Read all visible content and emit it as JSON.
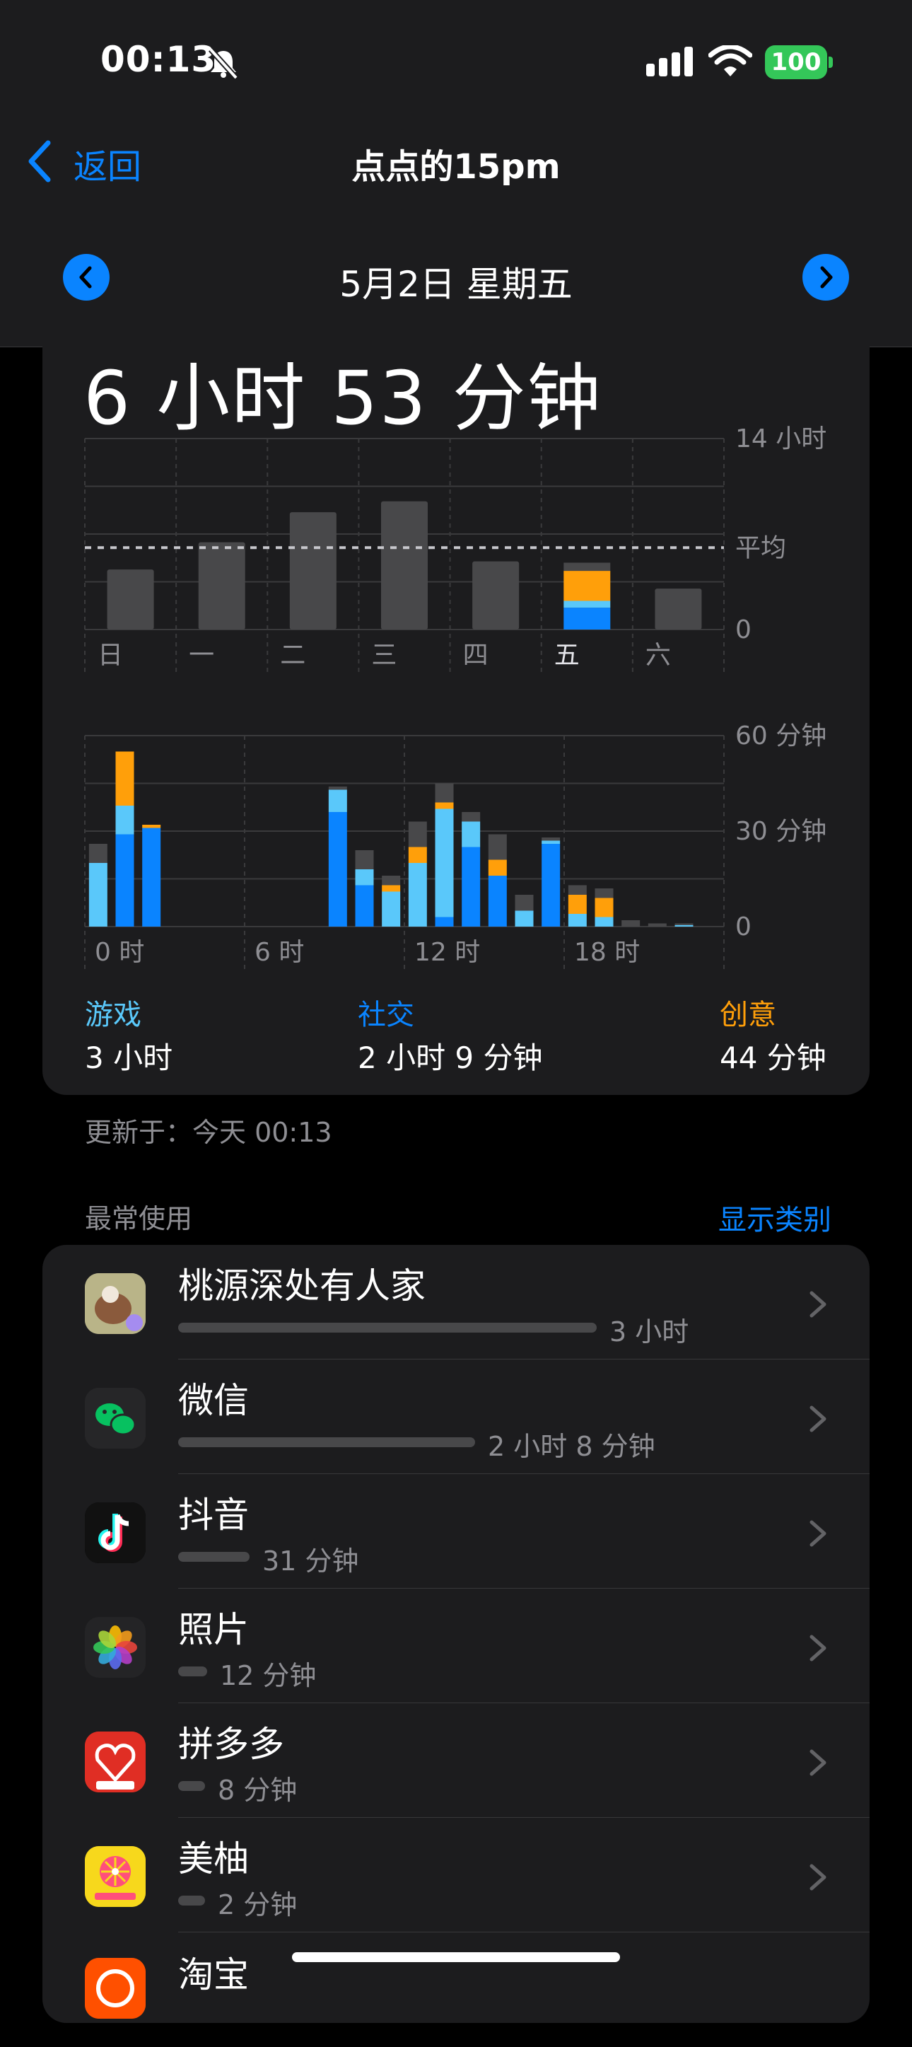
{
  "status": {
    "time": "00:13",
    "battery": "100"
  },
  "nav": {
    "back": "返回",
    "title": "点点的15pm"
  },
  "date": {
    "title": "5月2日 星期五"
  },
  "summary": {
    "total": "6 小时 53 分钟"
  },
  "colors": {
    "game": "#5ac8fa",
    "social": "#0a84ff",
    "creative": "#ff9f0a",
    "other": "#48484a",
    "accent": "#0a84ff"
  },
  "weekly": {
    "top_label": "14 小时",
    "avg_label": "平均",
    "zero_label": "0",
    "days": [
      "日",
      "一",
      "二",
      "三",
      "四",
      "五",
      "六"
    ],
    "totals_hours": [
      4.4,
      6.4,
      8.6,
      9.4,
      5.0,
      4.8,
      3.0
    ],
    "today": {
      "social": 1.6,
      "game": 0.5,
      "creative": 2.2,
      "other": 0.6
    },
    "average_hours": 6.0
  },
  "hourly": {
    "top_label": "60 分钟",
    "mid_label": "30 分钟",
    "zero_label": "0",
    "x_labels": [
      "0 时",
      "6 时",
      "12 时",
      "18 时"
    ],
    "bars": [
      {
        "h": 0,
        "social": 0,
        "game": 20,
        "creative": 0,
        "other": 6
      },
      {
        "h": 1,
        "social": 29,
        "game": 9,
        "creative": 17,
        "other": 0
      },
      {
        "h": 2,
        "social": 31,
        "game": 0,
        "creative": 1,
        "other": 0
      },
      {
        "h": 9,
        "social": 36,
        "game": 7,
        "creative": 0,
        "other": 1
      },
      {
        "h": 10,
        "social": 13,
        "game": 5,
        "creative": 0,
        "other": 6
      },
      {
        "h": 11,
        "social": 0,
        "game": 11,
        "creative": 2,
        "other": 3
      },
      {
        "h": 12,
        "social": 0,
        "game": 20,
        "creative": 5,
        "other": 8
      },
      {
        "h": 13,
        "social": 3,
        "game": 34,
        "creative": 2,
        "other": 6
      },
      {
        "h": 14,
        "social": 25,
        "game": 8,
        "creative": 0,
        "other": 3
      },
      {
        "h": 15,
        "social": 16,
        "game": 0,
        "creative": 5,
        "other": 8
      },
      {
        "h": 16,
        "social": 0,
        "game": 5,
        "creative": 0,
        "other": 5
      },
      {
        "h": 17,
        "social": 26,
        "game": 1,
        "creative": 0,
        "other": 1
      },
      {
        "h": 18,
        "social": 0,
        "game": 4,
        "creative": 6,
        "other": 3
      },
      {
        "h": 19,
        "social": 0,
        "game": 3,
        "creative": 6,
        "other": 3
      },
      {
        "h": 20,
        "social": 0,
        "game": 0,
        "creative": 0,
        "other": 2
      },
      {
        "h": 21,
        "social": 0,
        "game": 0,
        "creative": 0,
        "other": 1
      },
      {
        "h": 22,
        "social": 0,
        "game": 0.5,
        "creative": 0,
        "other": 0.5
      }
    ]
  },
  "categories": [
    {
      "name": "游戏",
      "value": "3 小时"
    },
    {
      "name": "社交",
      "value": "2 小时 9 分钟"
    },
    {
      "name": "创意",
      "value": "44 分钟"
    }
  ],
  "updated": "更新于：今天 00:13",
  "most_used": {
    "label": "最常使用",
    "show_categories": "显示类别"
  },
  "apps": [
    {
      "name": "桃源深处有人家",
      "duration": "3 小时",
      "fraction": 1.0,
      "icon": "taoyuan-game-icon"
    },
    {
      "name": "微信",
      "duration": "2 小时 8 分钟",
      "fraction": 0.71,
      "icon": "wechat-icon"
    },
    {
      "name": "抖音",
      "duration": "31 分钟",
      "fraction": 0.17,
      "icon": "douyin-icon"
    },
    {
      "name": "照片",
      "duration": "12 分钟",
      "fraction": 0.07,
      "icon": "photos-icon"
    },
    {
      "name": "拼多多",
      "duration": "8 分钟",
      "fraction": 0.05,
      "icon": "pinduoduo-icon"
    },
    {
      "name": "美柚",
      "duration": "2 分钟",
      "fraction": 0.05,
      "icon": "meiyou-icon"
    },
    {
      "name": "淘宝",
      "duration": "",
      "fraction": 0,
      "icon": "taobao-icon"
    }
  ]
}
